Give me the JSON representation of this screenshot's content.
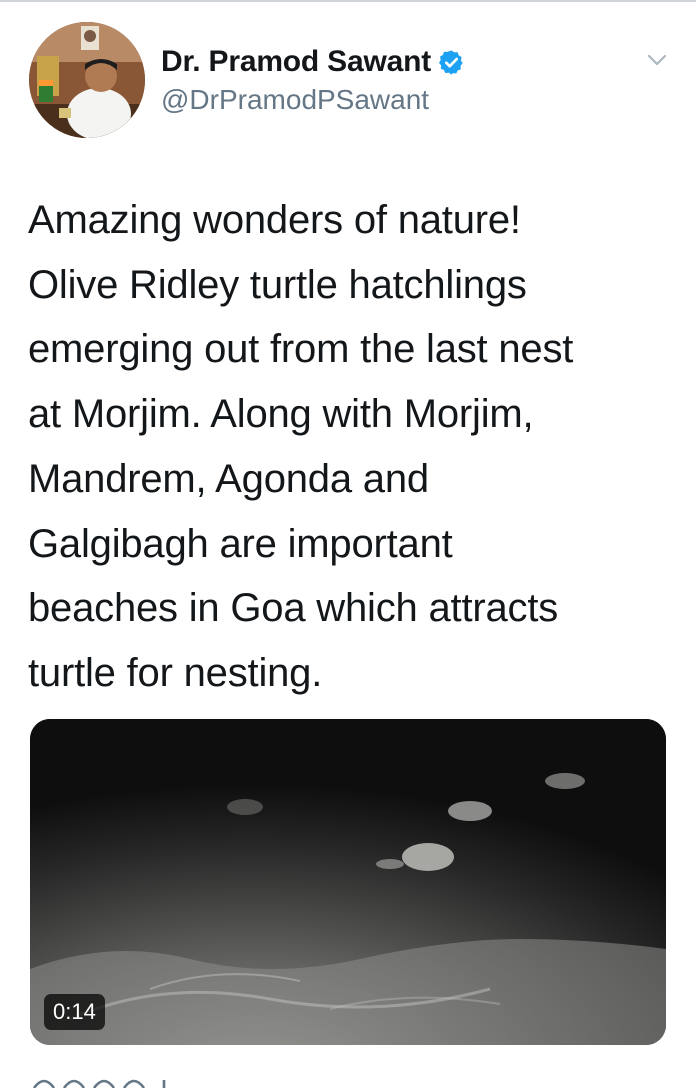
{
  "author": {
    "display_name": "Dr. Pramod Sawant",
    "handle": "@DrPramodPSawant",
    "verified": true
  },
  "tweet": {
    "text_lines": [
      "Amazing wonders of nature!",
      "Olive Ridley turtle hatchlings",
      "emerging out from the last nest",
      "at Morjim. Along with Morjim,",
      "Mandrem, Agonda and",
      "Galgibagh are important",
      "beaches in Goa which attracts",
      "turtle for nesting."
    ]
  },
  "media": {
    "type": "video",
    "duration": "0:14"
  },
  "colors": {
    "verified_badge": "#1da1f2",
    "secondary_text": "#657786",
    "primary_text": "#14171a"
  },
  "icons": {
    "more": "chevron-down-icon",
    "verified": "verified-badge-icon"
  }
}
